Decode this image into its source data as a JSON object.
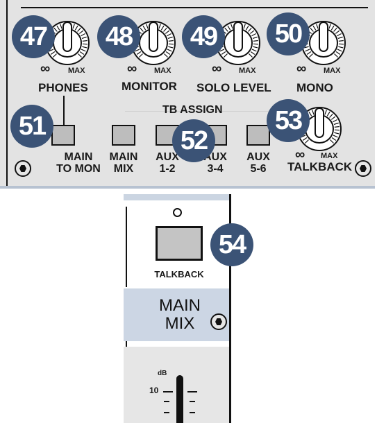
{
  "callouts": {
    "n47": "47",
    "n48": "48",
    "n49": "49",
    "n50": "50",
    "n51": "51",
    "n52": "52",
    "n53": "53",
    "n54": "54"
  },
  "knob_scale": {
    "min": "∞",
    "max": "MAX"
  },
  "knob_labels": {
    "phones": "PHONES",
    "monitor": "MONITOR",
    "solo_level": "SOLO LEVEL",
    "mono": "MONO",
    "talkback": "TALKBACK"
  },
  "tb_assign": {
    "title": "TB ASSIGN",
    "main_to_mon": [
      "MAIN",
      "TO MON"
    ],
    "main_mix": [
      "MAIN",
      "MIX"
    ],
    "aux12": [
      "AUX",
      "1-2"
    ],
    "aux34": [
      "AUX",
      "3-4"
    ],
    "aux56": [
      "AUX",
      "5-6"
    ]
  },
  "strip": {
    "talkback_button": "TALKBACK",
    "main_mix_title": [
      "MAIN",
      "MIX"
    ],
    "fader_unit": "dB",
    "fader_tick": "10"
  },
  "colors": {
    "panel": "#e3e3e3",
    "badge": "#3b5376",
    "main_mix_section": "#ccd6e4"
  }
}
